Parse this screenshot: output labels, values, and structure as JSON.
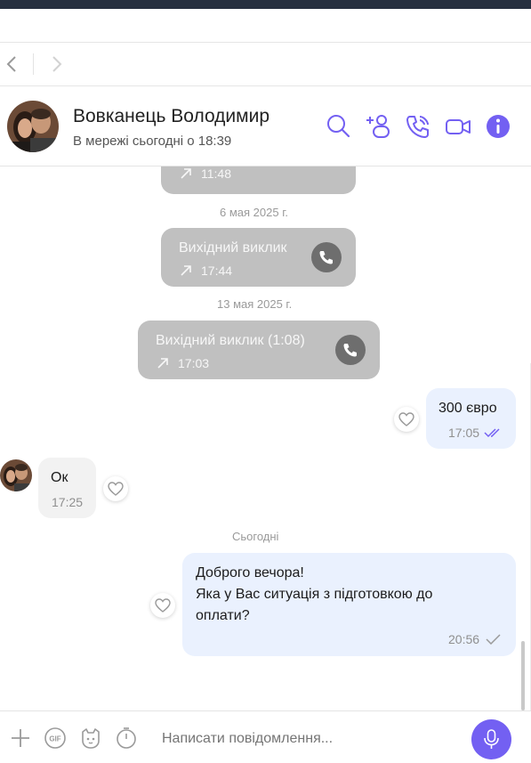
{
  "nav": {
    "back_icon": "chevron-left-icon",
    "forward_icon": "chevron-right-icon"
  },
  "contact": {
    "name": "Вовканець Володимир",
    "status": "В мережі сьогодні о 18:39"
  },
  "header_icons": [
    "search-icon",
    "add-participant-icon",
    "voice-call-icon",
    "video-call-icon",
    "info-icon"
  ],
  "colors": {
    "accent": "#7360f2",
    "topbar": "#27303f",
    "outgoing_bubble": "#eaf1fe",
    "incoming_bubble": "#f2f2f2",
    "call_bubble": "#c0c0c0"
  },
  "messages": {
    "call_partial": {
      "time": "11:48"
    },
    "date1": "6 мая 2025 г.",
    "call1": {
      "title": "Вихідний виклик",
      "time": "17:44"
    },
    "date2": "13 мая 2025 г.",
    "call2": {
      "title": "Вихідний виклик  (1:08)",
      "time": "17:03"
    },
    "out1": {
      "text": "300 євро",
      "time": "17:05"
    },
    "in1": {
      "text": "Ок",
      "time": "17:25"
    },
    "date3": "Сьогодні",
    "out2": {
      "line1": "Доброго вечора!",
      "line2": "Яка у Вас ситуація з підготовкою до",
      "line3": "оплати?",
      "time": "20:56"
    }
  },
  "composer": {
    "placeholder": "Написати повідомлення...",
    "icons": [
      "plus-icon",
      "gif-icon",
      "sticker-icon",
      "timer-icon",
      "microphone-icon"
    ]
  }
}
